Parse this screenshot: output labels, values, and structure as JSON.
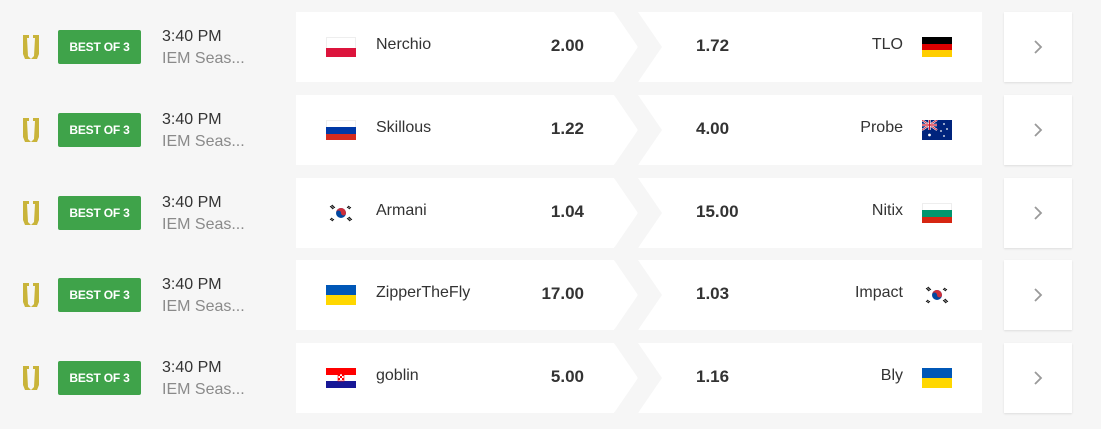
{
  "matches": [
    {
      "badge": "BEST OF 3",
      "time": "3:40 PM",
      "tournament": "IEM Seas...",
      "p1": {
        "name": "Nerchio",
        "odd": "2.00",
        "flag": "poland-flag"
      },
      "p2": {
        "name": "TLO",
        "odd": "1.72",
        "flag": "germany-flag"
      }
    },
    {
      "badge": "BEST OF 3",
      "time": "3:40 PM",
      "tournament": "IEM Seas...",
      "p1": {
        "name": "Skillous",
        "odd": "1.22",
        "flag": "russia-flag"
      },
      "p2": {
        "name": "Probe",
        "odd": "4.00",
        "flag": "australia-flag"
      }
    },
    {
      "badge": "BEST OF 3",
      "time": "3:40 PM",
      "tournament": "IEM Seas...",
      "p1": {
        "name": "Armani",
        "odd": "1.04",
        "flag": "south-korea-flag"
      },
      "p2": {
        "name": "Nitix",
        "odd": "15.00",
        "flag": "bulgaria-flag"
      }
    },
    {
      "badge": "BEST OF 3",
      "time": "3:40 PM",
      "tournament": "IEM Seas...",
      "p1": {
        "name": "ZipperTheFly",
        "odd": "17.00",
        "flag": "ukraine-flag"
      },
      "p2": {
        "name": "Impact",
        "odd": "1.03",
        "flag": "south-korea-flag"
      }
    },
    {
      "badge": "BEST OF 3",
      "time": "3:40 PM",
      "tournament": "IEM Seas...",
      "p1": {
        "name": "goblin",
        "odd": "5.00",
        "flag": "croatia-flag"
      },
      "p2": {
        "name": "Bly",
        "odd": "1.16",
        "flag": "ukraine-flag"
      }
    }
  ],
  "colors": {
    "badge": "#3fa34a",
    "game_icon": "#c9b43a",
    "card": "#ffffff",
    "background": "#f6f6f6"
  },
  "icons": {
    "game": "starcraft-ii-icon",
    "details": "chevron-right-icon"
  }
}
